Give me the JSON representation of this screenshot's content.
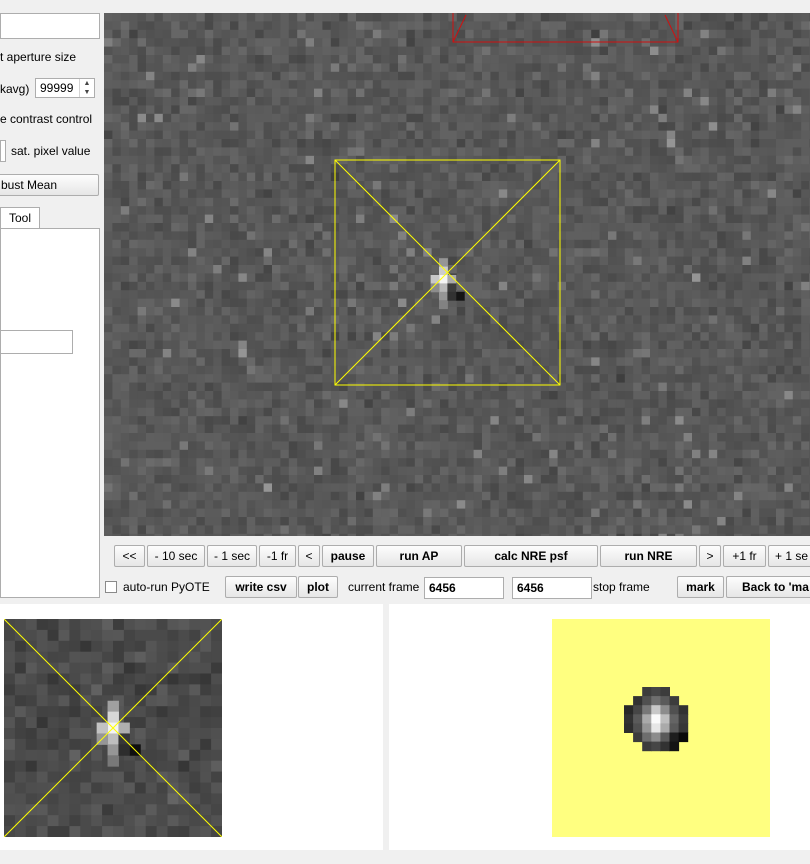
{
  "left_panel": {
    "aperture_size_label": "t aperture size",
    "avg_label": "kavg)",
    "avg_value": "99999",
    "contrast_label": "e contrast control",
    "sat_label": "sat. pixel value",
    "robust_mean_button": "bust Mean",
    "tool_tab": "Tool"
  },
  "controls": {
    "buttons": [
      "<<",
      "- 10 sec",
      "- 1 sec",
      "-1 fr",
      "<",
      "pause",
      "run AP",
      "calc NRE psf",
      "run NRE",
      ">",
      "+1 fr",
      "+ 1 se"
    ],
    "auto_run_label": "auto-run PyOTE",
    "write_csv": "write csv",
    "plot": "plot",
    "current_frame_label": "current frame",
    "current_frame_value": "6456",
    "stop_frame_value": "6456",
    "stop_frame_label": "stop frame",
    "mark": "mark",
    "back_to": "Back to 'ma"
  },
  "colors": {
    "aperture": "#ffff00",
    "red_aperture": "#d01010",
    "thumb_bg": "#ffff80"
  }
}
